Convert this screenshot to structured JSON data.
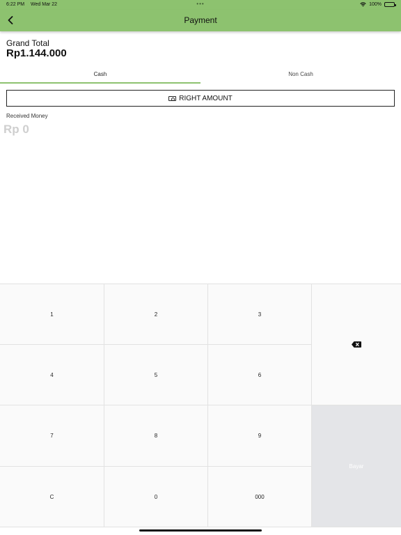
{
  "status_bar": {
    "time": "6:22 PM",
    "date": "Wed Mar 22",
    "dots": "•••",
    "battery": "100%"
  },
  "header": {
    "title": "Payment",
    "back_icon": "chevron-left-icon"
  },
  "summary": {
    "grand_total_label": "Grand Total",
    "grand_total_value": "Rp1.144.000"
  },
  "tabs": [
    {
      "label": "Cash",
      "active": true
    },
    {
      "label": "Non Cash",
      "active": false
    }
  ],
  "right_amount": {
    "label": "RIGHT AMOUNT",
    "icon": "cash-icon"
  },
  "received": {
    "label": "Received Money",
    "placeholder": "Rp 0"
  },
  "keypad": {
    "keys": [
      "1",
      "2",
      "3",
      "4",
      "5",
      "6",
      "7",
      "8",
      "9",
      "C",
      "0",
      "000"
    ],
    "backspace_icon": "backspace-icon",
    "pay_label": "Bayar"
  },
  "colors": {
    "accent": "#8dc26f",
    "keypad_bg": "#fafafa",
    "pay_bg": "#e4e5e8"
  }
}
